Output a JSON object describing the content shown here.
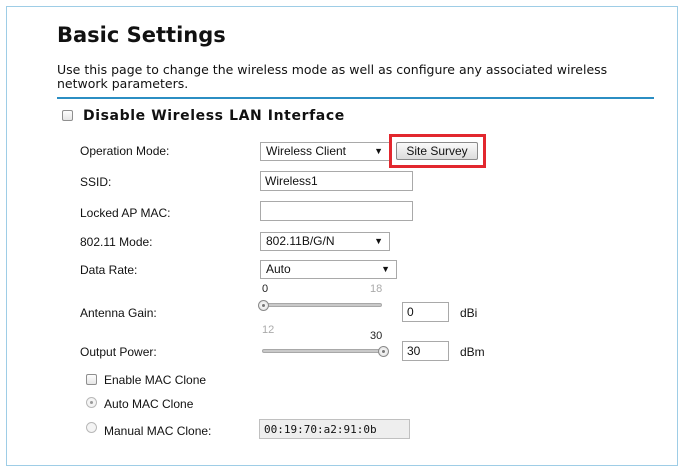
{
  "header": {
    "title": "Basic Settings",
    "description": "Use this page to change the wireless mode as well as configure any associated wireless network parameters."
  },
  "disable_wlan": {
    "label": "Disable Wireless LAN Interface",
    "checked": false
  },
  "form": {
    "operation_mode": {
      "label": "Operation Mode:",
      "value": "Wireless Client"
    },
    "site_survey_label": "Site Survey",
    "ssid": {
      "label": "SSID:",
      "value": "Wireless1"
    },
    "locked_ap_mac": {
      "label": "Locked AP MAC:",
      "value": ""
    },
    "mode_80211": {
      "label": "802.11 Mode:",
      "value": "802.11B/G/N"
    },
    "data_rate": {
      "label": "Data Rate:",
      "value": "Auto"
    },
    "antenna_gain": {
      "label": "Antenna Gain:",
      "min": "0",
      "max": "18",
      "value": "0",
      "unit": "dBi"
    },
    "output_power": {
      "label": "Output Power:",
      "min": "12",
      "max": "30",
      "value": "30",
      "unit": "dBm"
    },
    "mac_clone": {
      "enable_label": "Enable MAC Clone",
      "auto_label": "Auto MAC Clone",
      "manual_label": "Manual MAC Clone:",
      "manual_value": "00:19:70:a2:91:0b"
    }
  },
  "colors": {
    "accent_rule": "#2b8ec3",
    "highlight": "#e2272e",
    "frame": "#9ecde6"
  }
}
